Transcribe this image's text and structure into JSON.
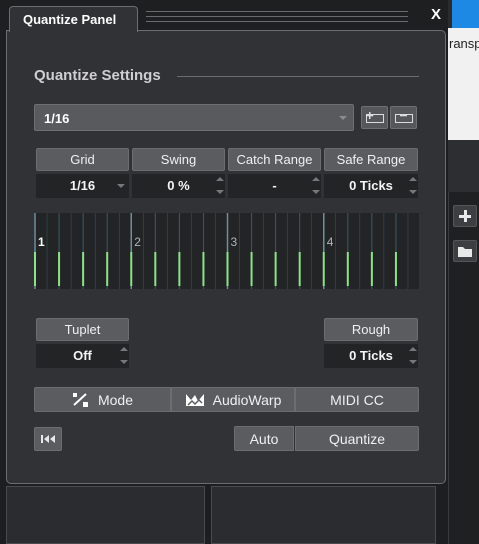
{
  "window": {
    "title": "Quantize Panel",
    "close_label": "X"
  },
  "background": {
    "partial_text": "ransp"
  },
  "section": {
    "title": "Quantize Settings"
  },
  "preset": {
    "value": "1/16"
  },
  "params": {
    "grid": {
      "label": "Grid",
      "value": "1/16"
    },
    "swing": {
      "label": "Swing",
      "value": "0 %"
    },
    "catch_range": {
      "label": "Catch Range",
      "value": "-"
    },
    "safe_range": {
      "label": "Safe Range",
      "value": "0 Ticks"
    },
    "tuplet": {
      "label": "Tuplet",
      "value": "Off"
    },
    "rough": {
      "label": "Rough",
      "value": "0 Ticks"
    }
  },
  "grid_display": {
    "beat_labels": [
      "1",
      "2",
      "3",
      "4"
    ]
  },
  "buttons": {
    "mode": "Mode",
    "audiowarp": "AudioWarp",
    "midi_cc": "MIDI CC",
    "auto": "Auto",
    "quantize": "Quantize"
  },
  "colors": {
    "panel_bg": "#313235",
    "accent_green": "#8ee08a",
    "grid_line": "#3b5a6a",
    "beat_line": "#6f8fa0"
  },
  "icons": {
    "add_preset": "add-preset-icon",
    "remove_preset": "remove-preset-icon",
    "mode": "quantize-mode-icon",
    "audiowarp": "audiowarp-icon",
    "reset": "reset-to-start-icon"
  }
}
